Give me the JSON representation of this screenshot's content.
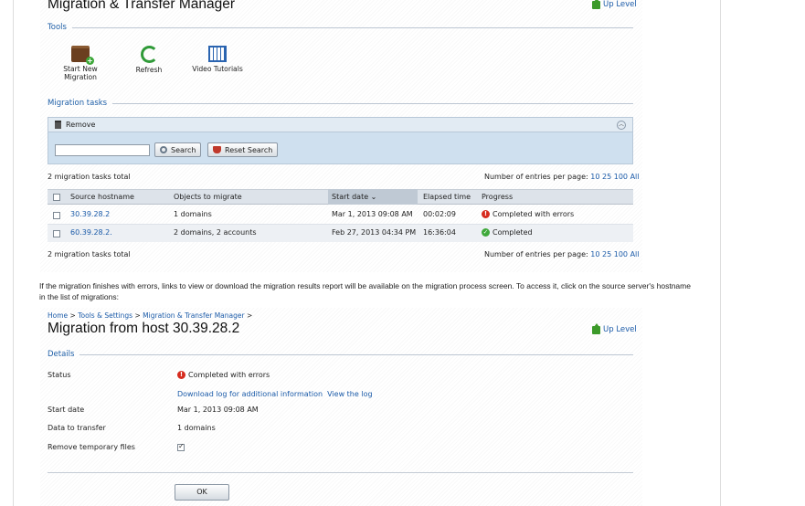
{
  "screen1": {
    "title": "Migration & Transfer Manager",
    "up_level": "Up Level",
    "tools_heading": "Tools",
    "tools": [
      {
        "label": "Start New Migration",
        "icon": "briefcase-add-icon"
      },
      {
        "label": "Refresh",
        "icon": "refresh-icon"
      },
      {
        "label": "Video Tutorials",
        "icon": "film-icon"
      }
    ],
    "tasks_heading": "Migration tasks",
    "remove_label": "Remove",
    "search_label": "Search",
    "reset_search_label": "Reset Search",
    "total_top": "2 migration tasks total",
    "total_bottom": "2 migration tasks total",
    "entries_label": "Number of entries per page:",
    "entries_options": [
      "10",
      "25",
      "100",
      "All"
    ],
    "columns": [
      "Source hostname",
      "Objects to migrate",
      "Start date",
      "Elapsed time",
      "Progress"
    ],
    "rows": [
      {
        "host": "30.39.28.2",
        "objects": "1 domains",
        "start": "Mar 1, 2013 09:08 AM",
        "elapsed": "00:02:09",
        "progress": "Completed with errors",
        "status": "error"
      },
      {
        "host": "60.39.28.2.",
        "objects": "2 domains, 2 accounts",
        "start": "Feb 27, 2013 04:34 PM",
        "elapsed": "16:36:04",
        "progress": "Completed",
        "status": "ok"
      }
    ]
  },
  "caption": "If the migration finishes with errors, links to view or download the migration results report will be available on the migration process screen. To access it, click on the source server's hostname in the list of migrations:",
  "screen2": {
    "breadcrumb": [
      "Home",
      "Tools & Settings",
      "Migration & Transfer Manager"
    ],
    "breadcrumb_sep": ">",
    "title": "Migration from host 30.39.28.2",
    "up_level": "Up Level",
    "details_heading": "Details",
    "status_label": "Status",
    "status_value": "Completed with errors",
    "download_log": "Download log for additional information",
    "view_log": "View the log",
    "start_date_label": "Start date",
    "start_date_value": "Mar 1, 2013 09:08 AM",
    "data_label": "Data to transfer",
    "data_value": "1 domains",
    "remove_temp_label": "Remove temporary files",
    "remove_temp_checked": true,
    "ok_label": "OK"
  },
  "colors": {
    "link": "#1a5aa8",
    "error": "#d62b1e",
    "ok": "#3ea83a",
    "panel": "#cfe0ef"
  }
}
